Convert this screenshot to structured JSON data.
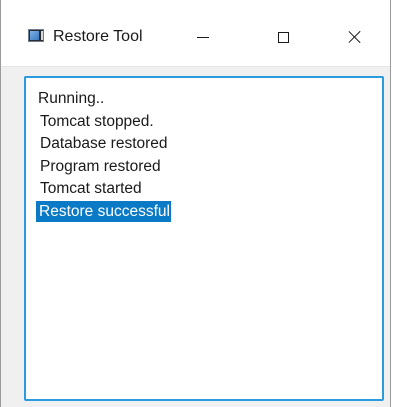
{
  "window": {
    "title": "Restore Tool",
    "icon": "app-window-icon",
    "controls": {
      "minimize": "minimize-icon",
      "maximize": "maximize-icon",
      "close": "close-icon"
    }
  },
  "log": {
    "lines": [
      "Running..",
      " Tomcat stopped.",
      " Database restored",
      " Program restored",
      " Tomcat started",
      " Restore successful"
    ],
    "selected_index": 5
  },
  "colors": {
    "focus_border": "#2b9be0",
    "selection_background": "#0a7ac6"
  }
}
